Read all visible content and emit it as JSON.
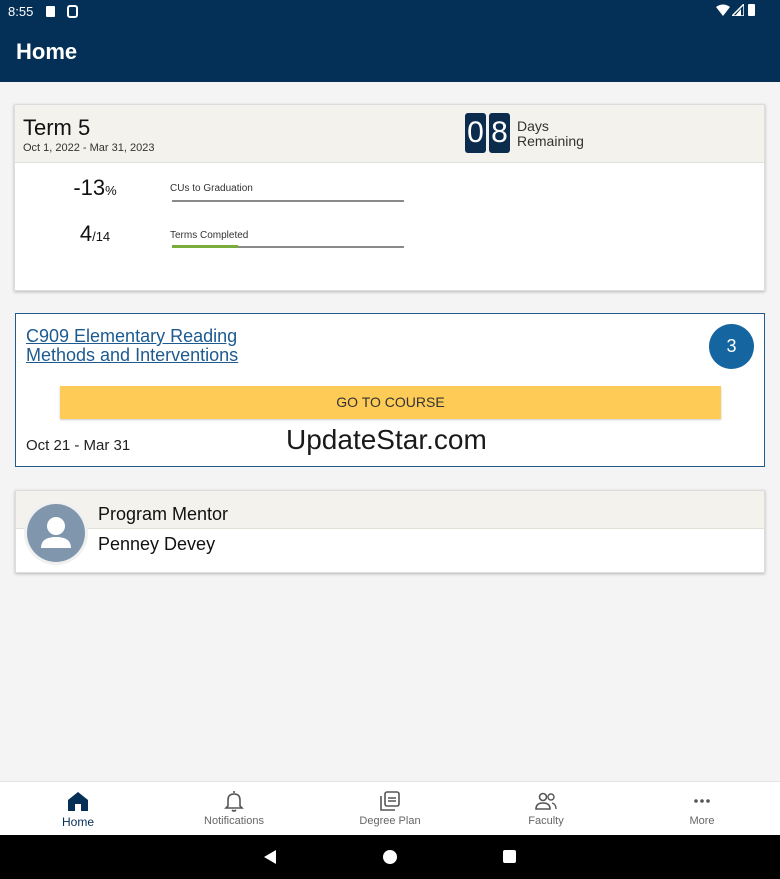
{
  "status": {
    "time": "8:55"
  },
  "app": {
    "title": "Home"
  },
  "term": {
    "title": "Term 5",
    "dates": "Oct 1, 2022 - Mar 31, 2023",
    "days_digits": [
      "0",
      "8"
    ],
    "days_label_1": "Days",
    "days_label_2": "Remaining",
    "cus_value": "-13",
    "cus_suffix": "%",
    "cus_label": "CUs to Graduation",
    "cus_progress": 0,
    "terms_value": "4",
    "terms_suffix": "/14",
    "terms_label": "Terms Completed",
    "terms_progress": 0.2857
  },
  "course": {
    "title_line1": "C909 Elementary Reading",
    "title_line2": "Methods and Interventions",
    "badge": "3",
    "button_label": "GO TO COURSE",
    "dates": "Oct 21 - Mar 31"
  },
  "watermark": "UpdateStar.com",
  "mentor": {
    "role": "Program Mentor",
    "name": "Penney Devey"
  },
  "nav": {
    "items": [
      {
        "label": "Home",
        "icon": "home-icon"
      },
      {
        "label": "Notifications",
        "icon": "bell-icon"
      },
      {
        "label": "Degree Plan",
        "icon": "degree-plan-icon"
      },
      {
        "label": "Faculty",
        "icon": "faculty-icon"
      },
      {
        "label": "More",
        "icon": "more-icon"
      }
    ],
    "active": "Home"
  },
  "colors": {
    "appbar": "#043057",
    "accent_yellow": "#fdcb56",
    "badge_blue": "#1565a0",
    "progress_green": "#7aac3c"
  }
}
